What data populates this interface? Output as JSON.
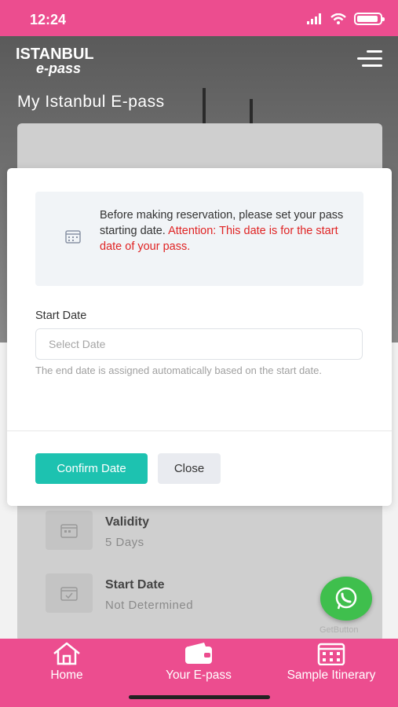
{
  "status_bar": {
    "time": "12:24"
  },
  "header": {
    "logo_line1": "ISTANBUL",
    "logo_line2": "e-pass",
    "page_title": "My Istanbul E-pass"
  },
  "modal": {
    "alert_text": "Before making reservation, please set your pass starting date.",
    "alert_warning": "Attention: This date is for the start date of your pass.",
    "field_label": "Start Date",
    "field_placeholder": "Select Date",
    "field_value": "",
    "help_text": "The end date is assigned automatically based on the start date.",
    "confirm_label": "Confirm Date",
    "close_label": "Close"
  },
  "pass_info": [
    {
      "title": "Validity",
      "value": "5 Days",
      "icon": "calendar-icon"
    },
    {
      "title": "Start Date",
      "value": "Not Determined",
      "icon": "calendar-check-icon"
    }
  ],
  "widget": {
    "caption": "GetButton",
    "icon": "whatsapp-icon"
  },
  "tabs": [
    {
      "label": "Home",
      "icon": "home-icon"
    },
    {
      "label": "Your E-pass",
      "icon": "wallet-icon"
    },
    {
      "label": "Sample Itinerary",
      "icon": "calendar-icon"
    }
  ],
  "colors": {
    "brand_pink": "#ec4d8f",
    "accent_teal": "#1dc2b0",
    "warning_red": "#e02424",
    "whatsapp_green": "#3fbf4d"
  }
}
